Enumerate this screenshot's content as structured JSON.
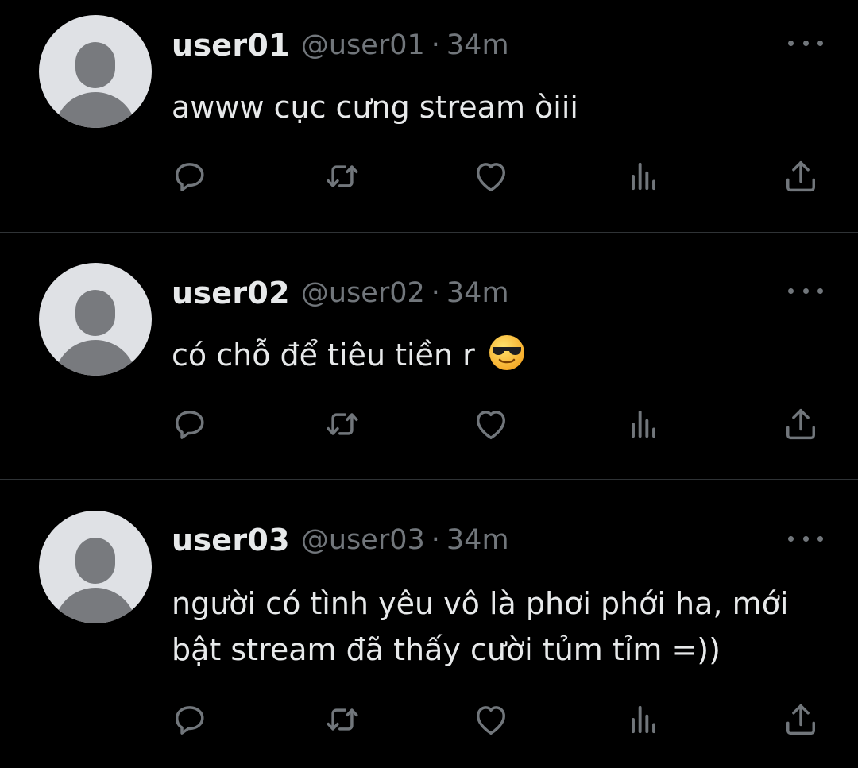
{
  "tweets": [
    {
      "display_name": "user01",
      "handle": "@user01",
      "separator": "·",
      "time": "34m",
      "text": "awww cục cưng stream òiii"
    },
    {
      "display_name": "user02",
      "handle": "@user02",
      "separator": "·",
      "time": "34m",
      "text": "có chỗ để tiêu tiền r",
      "emoji": "smiling-face-with-sunglasses"
    },
    {
      "display_name": "user03",
      "handle": "@user03",
      "separator": "·",
      "time": "34m",
      "text_line1": "người có tình yêu vô là phơi phới ha, mới",
      "text_line2": "bật stream đã thấy cười tủm tỉm =))"
    }
  ],
  "icons": {
    "reply": "reply-icon",
    "retweet": "retweet-icon",
    "like": "heart-icon",
    "views": "analytics-icon",
    "share": "share-icon",
    "more": "more-options-icon"
  },
  "colors": {
    "background": "#000000",
    "primary_text": "#e7e9ea",
    "secondary_text": "#71767b",
    "divider": "#2f3336",
    "avatar_bg": "#dfe1e5",
    "avatar_fg": "#787a7e"
  }
}
